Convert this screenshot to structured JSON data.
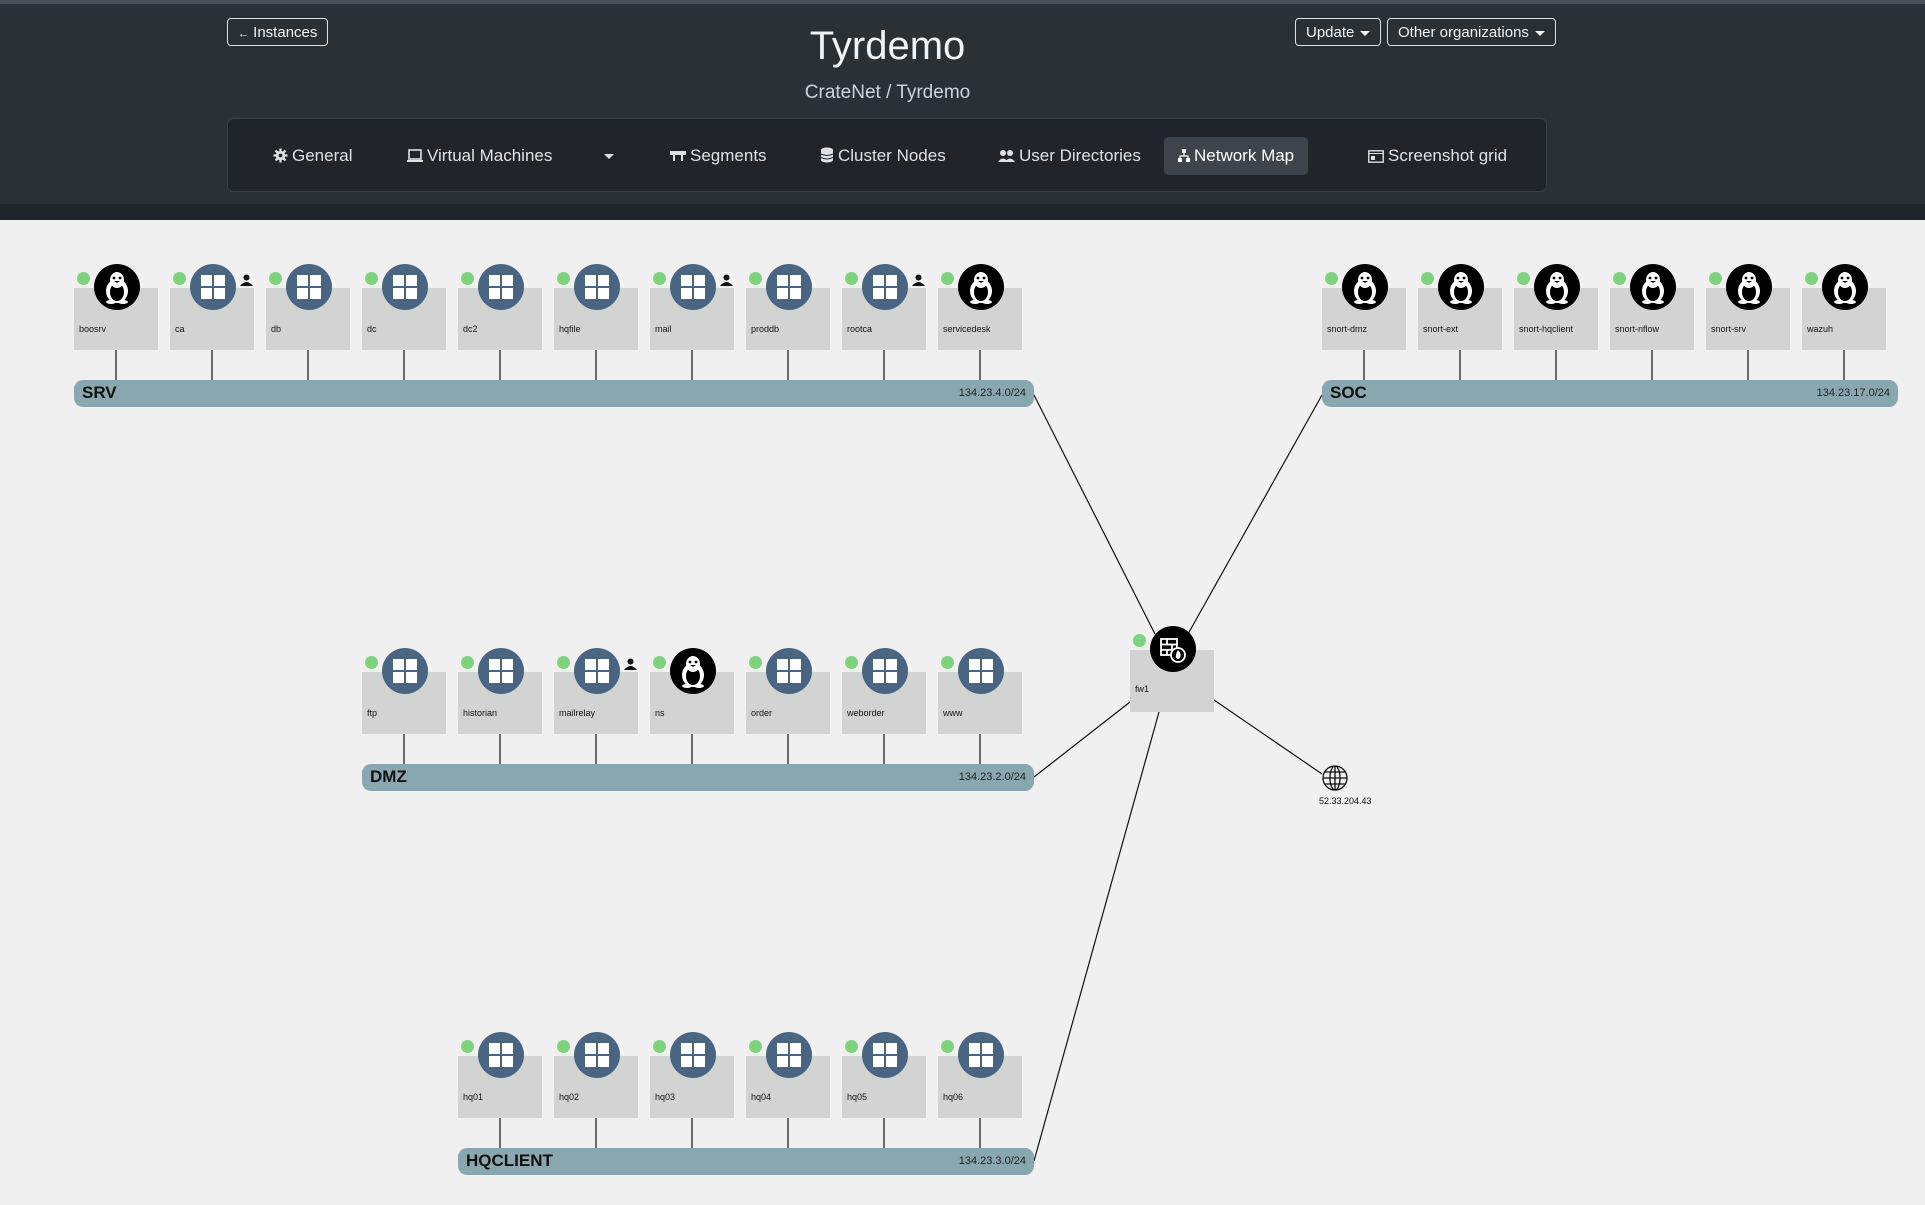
{
  "header": {
    "instances_button": "Instances",
    "title": "Tyrdemo",
    "subtitle": "CrateNet / Tyrdemo",
    "update_button": "Update",
    "orgs_button": "Other organizations"
  },
  "nav": {
    "general": "General",
    "virtual_machines": "Virtual Machines",
    "segments": "Segments",
    "cluster_nodes": "Cluster Nodes",
    "user_directories": "User Directories",
    "network_map": "Network Map",
    "screenshot_grid": "Screenshot grid"
  },
  "colors": {
    "status_up": "#7fd37f",
    "segment": "#8aa7b0",
    "windows": "#4a6582",
    "linux": "#000000"
  },
  "segments": {
    "srv": {
      "name": "SRV",
      "cidr": "134.23.4.0/24"
    },
    "soc": {
      "name": "SOC",
      "cidr": "134.23.17.0/24"
    },
    "dmz": {
      "name": "DMZ",
      "cidr": "134.23.2.0/24"
    },
    "hqclient": {
      "name": "HQCLIENT",
      "cidr": "134.23.3.0/24"
    }
  },
  "nodes": {
    "srv": [
      {
        "name": "boosrv",
        "os": "linux-icon",
        "user": false
      },
      {
        "name": "ca",
        "os": "windows-icon",
        "user": true
      },
      {
        "name": "db",
        "os": "windows-icon",
        "user": false
      },
      {
        "name": "dc",
        "os": "windows-icon",
        "user": false
      },
      {
        "name": "dc2",
        "os": "windows-icon",
        "user": false
      },
      {
        "name": "hqfile",
        "os": "windows-icon",
        "user": false
      },
      {
        "name": "mail",
        "os": "windows-icon",
        "user": true
      },
      {
        "name": "proddb",
        "os": "windows-icon",
        "user": false
      },
      {
        "name": "rootca",
        "os": "windows-icon",
        "user": true
      },
      {
        "name": "servicedesk",
        "os": "linux-icon",
        "user": false
      }
    ],
    "soc": [
      {
        "name": "snort-dmz",
        "os": "linux-icon",
        "user": false
      },
      {
        "name": "snort-ext",
        "os": "linux-icon",
        "user": false
      },
      {
        "name": "snort-hqclient",
        "os": "linux-icon",
        "user": false
      },
      {
        "name": "snort-nflow",
        "os": "linux-icon",
        "user": false
      },
      {
        "name": "snort-srv",
        "os": "linux-icon",
        "user": false
      },
      {
        "name": "wazuh",
        "os": "linux-icon",
        "user": false
      }
    ],
    "dmz": [
      {
        "name": "ftp",
        "os": "windows-icon",
        "user": false
      },
      {
        "name": "historian",
        "os": "windows-icon",
        "user": false
      },
      {
        "name": "mailrelay",
        "os": "windows-icon",
        "user": true
      },
      {
        "name": "ns",
        "os": "linux-icon",
        "user": false
      },
      {
        "name": "order",
        "os": "windows-icon",
        "user": false
      },
      {
        "name": "weborder",
        "os": "windows-icon",
        "user": false
      },
      {
        "name": "www",
        "os": "windows-icon",
        "user": false
      }
    ],
    "hqclient": [
      {
        "name": "hq01",
        "os": "windows-icon",
        "user": false
      },
      {
        "name": "hq02",
        "os": "windows-icon",
        "user": false
      },
      {
        "name": "hq03",
        "os": "windows-icon",
        "user": false
      },
      {
        "name": "hq04",
        "os": "windows-icon",
        "user": false
      },
      {
        "name": "hq05",
        "os": "windows-icon",
        "user": false
      },
      {
        "name": "hq06",
        "os": "windows-icon",
        "user": false
      }
    ]
  },
  "firewall": {
    "name": "fw1",
    "icon": "firewall-icon"
  },
  "external": {
    "ip": "52.33.204.43",
    "icon": "globe-icon"
  }
}
